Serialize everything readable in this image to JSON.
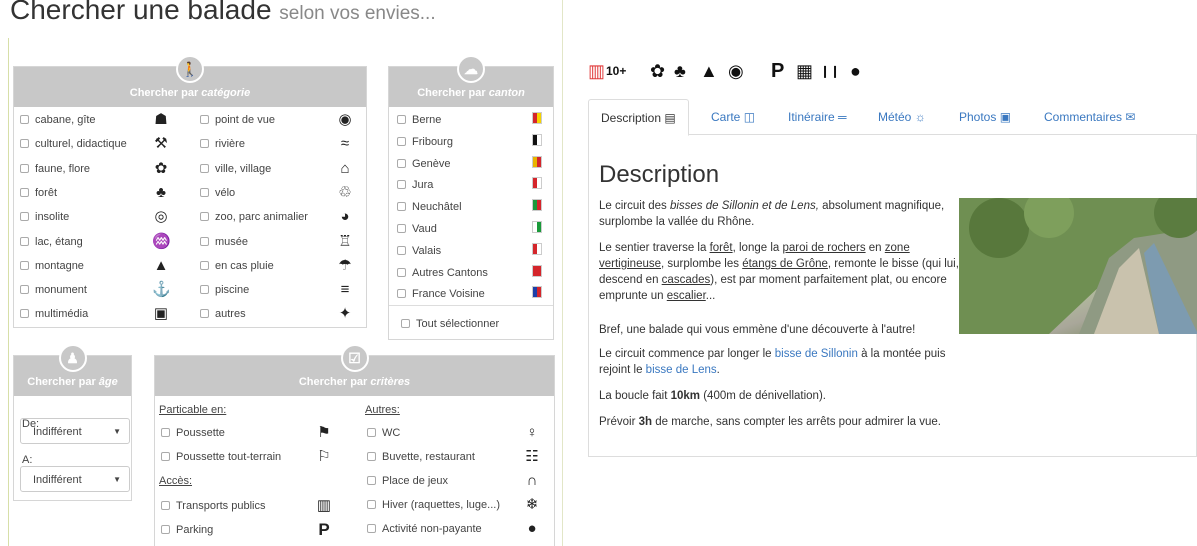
{
  "search": {
    "title": "Chercher une balade",
    "subtitle": "selon vos envies..."
  },
  "categorie": {
    "title_prefix": "Chercher par ",
    "title_em": "catégorie",
    "col1": [
      {
        "label": "cabane, gîte",
        "icon": "hut-icon"
      },
      {
        "label": "culturel, didactique",
        "icon": "tools-icon"
      },
      {
        "label": "faune, flore",
        "icon": "flower-icon"
      },
      {
        "label": "forêt",
        "icon": "forest-icon"
      },
      {
        "label": "insolite",
        "icon": "spiral-icon"
      },
      {
        "label": "lac, étang",
        "icon": "lake-icon"
      },
      {
        "label": "montagne",
        "icon": "mountain-icon"
      },
      {
        "label": "monument",
        "icon": "monument-icon"
      },
      {
        "label": "multimédia",
        "icon": "multimedia-icon"
      }
    ],
    "col2": [
      {
        "label": "point de vue",
        "icon": "eye-icon"
      },
      {
        "label": "rivière",
        "icon": "waves-icon"
      },
      {
        "label": "ville, village",
        "icon": "village-icon"
      },
      {
        "label": "vélo",
        "icon": "bike-icon"
      },
      {
        "label": "zoo, parc animalier",
        "icon": "elephant-icon"
      },
      {
        "label": "musée",
        "icon": "museum-icon"
      },
      {
        "label": "en cas pluie",
        "icon": "umbrella-icon"
      },
      {
        "label": "piscine",
        "icon": "pool-icon"
      },
      {
        "label": "autres",
        "icon": "paw-icon"
      }
    ]
  },
  "canton": {
    "title_prefix": "Chercher par ",
    "title_em": "canton",
    "items": [
      {
        "label": "Berne",
        "icon": "berne-flag-icon"
      },
      {
        "label": "Fribourg",
        "icon": "fribourg-flag-icon"
      },
      {
        "label": "Genève",
        "icon": "geneve-flag-icon"
      },
      {
        "label": "Jura",
        "icon": "jura-flag-icon"
      },
      {
        "label": "Neuchâtel",
        "icon": "neuchatel-flag-icon"
      },
      {
        "label": "Vaud",
        "icon": "vaud-flag-icon"
      },
      {
        "label": "Valais",
        "icon": "valais-flag-icon"
      },
      {
        "label": "Autres Cantons",
        "icon": "swiss-flag-icon"
      },
      {
        "label": "France Voisine",
        "icon": "france-flag-icon"
      }
    ],
    "select_all": "Tout sélectionner"
  },
  "age": {
    "title_prefix": "Chercher par ",
    "title_em": "âge",
    "from_label": "De:",
    "from_value": "Indifférent",
    "to_label": "A:",
    "to_value": "Indifférent"
  },
  "criteres": {
    "title_prefix": "Chercher par ",
    "title_em": "critères",
    "practicable_label": "Particable en:",
    "practicable": [
      {
        "label": "Poussette",
        "icon": "stroller-icon"
      },
      {
        "label": "Poussette tout-terrain",
        "icon": "offroad-stroller-icon"
      }
    ],
    "acces_label": "Accès:",
    "acces": [
      {
        "label": "Transports publics",
        "icon": "train-icon"
      },
      {
        "label": "Parking",
        "icon": "parking-icon"
      }
    ],
    "autres_label": "Autres:",
    "autres": [
      {
        "label": "WC",
        "icon": "wc-icon"
      },
      {
        "label": "Buvette, restaurant",
        "icon": "restaurant-icon"
      },
      {
        "label": "Place de jeux",
        "icon": "playground-icon"
      },
      {
        "label": "Hiver (raquettes, luge...)",
        "icon": "snowflake-icon"
      },
      {
        "label": "Activité non-payante",
        "icon": "piggy-bank-icon"
      }
    ]
  },
  "detail": {
    "badge": "10+",
    "tabs": [
      "Description",
      "Carte",
      "Itinéraire",
      "Météo",
      "Photos",
      "Commentaires"
    ],
    "heading": "Description",
    "p1_a": "Le circuit des ",
    "p1_em": "bisses de Sillonin et de Lens,",
    "p1_b": " absolument magnifique, surplombe la vallée du Rhône.",
    "p2_a": "Le sentier traverse la ",
    "p2_l1": "forêt",
    "p2_b": ",  longe la ",
    "p2_l2": "paroi de rochers",
    "p2_c": " en ",
    "p2_l3": "zone vertigineuse",
    "p2_d": ", surplombe les ",
    "p2_l4": "étangs de Grône",
    "p2_e": ", remonte le bisse (qui lui, descend en ",
    "p2_l5": "cascades",
    "p2_f": "), est par moment parfaitement plat, ou encore emprunte un ",
    "p2_l6": "escalier",
    "p2_g": "...",
    "p3": "Bref, une balade qui vous emmène d'une découverte à l'autre!",
    "p4_a": "Le circuit commence par longer le ",
    "p4_l1": "bisse de Sillonin",
    "p4_b": " à la montée puis rejoint le ",
    "p4_l2": "bisse de Lens",
    "p4_c": ".",
    "p5_a": "La boucle fait ",
    "p5_b": "10km",
    "p5_c": " (400m de dénivellation).",
    "p6_a": "Prévoir ",
    "p6_b": "3h",
    "p6_c": " de marche, sans compter les arrêts pour admirer la vue."
  }
}
